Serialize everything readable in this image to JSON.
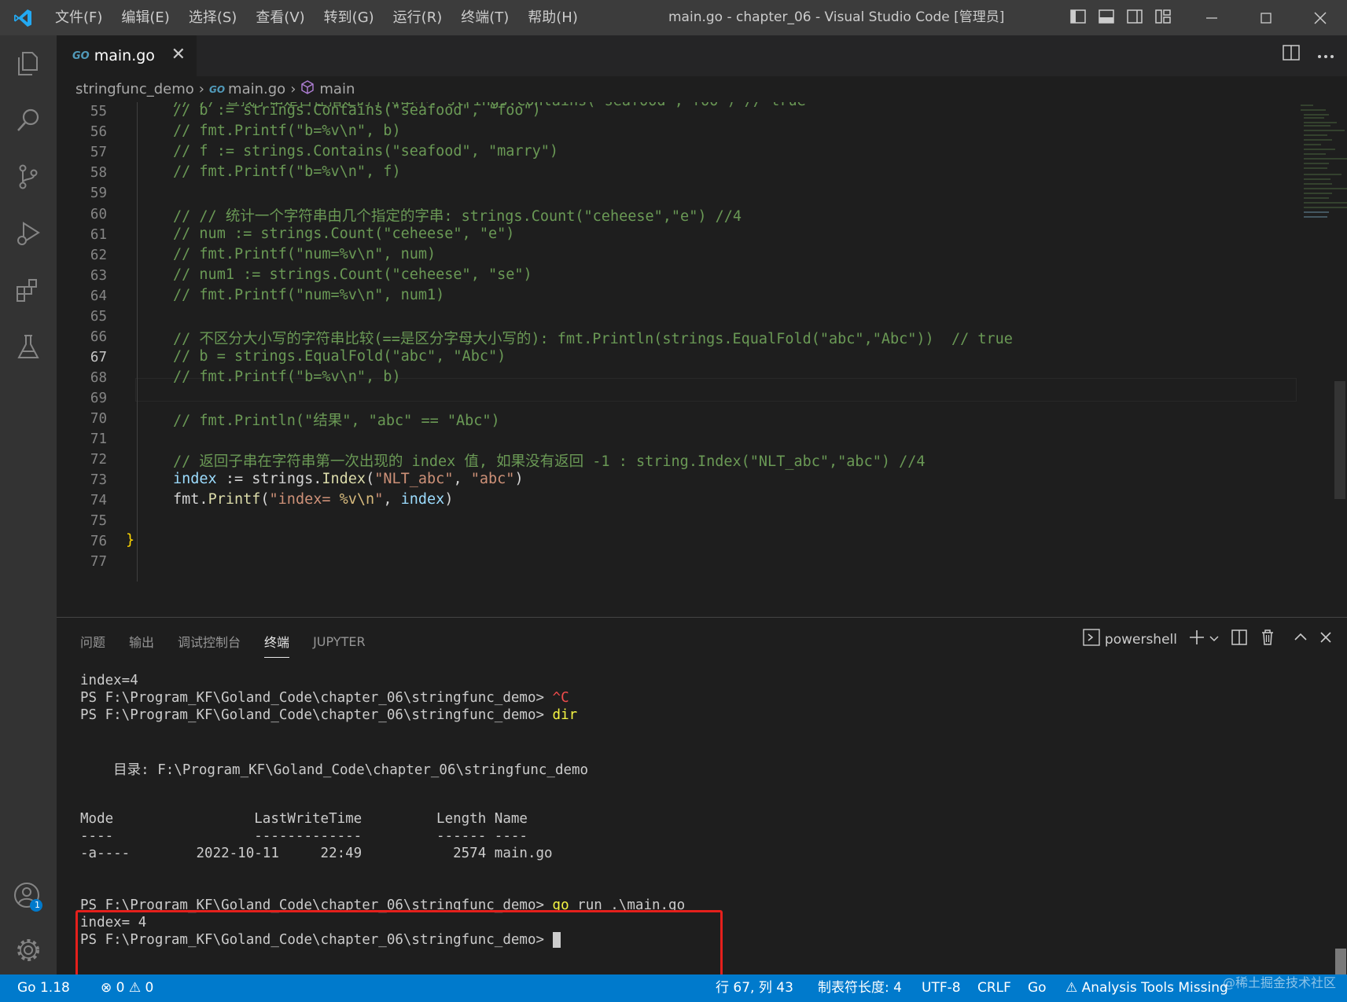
{
  "titlebar": {
    "menus": [
      "文件(F)",
      "编辑(E)",
      "选择(S)",
      "查看(V)",
      "转到(G)",
      "运行(R)",
      "终端(T)",
      "帮助(H)"
    ],
    "title": "main.go - chapter_06 - Visual Studio Code [管理员]"
  },
  "tab": {
    "icon_label": "GO",
    "name": "main.go",
    "close": "✕"
  },
  "breadcrumb": {
    "folder": "stringfunc_demo",
    "file": "main.go",
    "symbol": "main"
  },
  "editor": {
    "line_numbers": [
      "55",
      "56",
      "57",
      "58",
      "59",
      "60",
      "61",
      "62",
      "63",
      "64",
      "65",
      "66",
      "67",
      "68",
      "69",
      "70",
      "71",
      "72",
      "73",
      "74",
      "75",
      "76",
      "77"
    ],
    "current_line": "67",
    "partial_top_line": "// // 查找子串是否在指定的字符串中: strings.Contains(\"seafood\",\"foo\") // true",
    "lines": {
      "l55": "// b := strings.Contains(\"seafood\", \"foo\")",
      "l56": "// fmt.Printf(\"b=%v\\n\", b)",
      "l57": "// f := strings.Contains(\"seafood\", \"marry\")",
      "l58": "// fmt.Printf(\"b=%v\\n\", f)",
      "l60": "// // 统计一个字符串由几个指定的字串: strings.Count(\"ceheese\",\"e\") //4",
      "l61": "// num := strings.Count(\"ceheese\", \"e\")",
      "l62": "// fmt.Printf(\"num=%v\\n\", num)",
      "l63": "// num1 := strings.Count(\"ceheese\", \"se\")",
      "l64": "// fmt.Printf(\"num=%v\\n\", num1)",
      "l66": "// 不区分大小写的字符串比较(==是区分字母大小写的): fmt.Println(strings.EqualFold(\"abc\",\"Abc\"))  // true",
      "l67": "// b = strings.EqualFold(\"abc\", \"Abc\")",
      "l68": "// fmt.Printf(\"b=%v\\n\", b)",
      "l70": "// fmt.Println(\"结果\", \"abc\" == \"Abc\")",
      "l72": "// 返回子串在字符串第一次出现的 index 值, 如果没有返回 -1 : string.Index(\"NLT_abc\",\"abc\") //4",
      "l73": {
        "var": "index",
        "op": " := ",
        "pkg": "strings.",
        "fn": "Index",
        "open": "(",
        "a1": "\"NLT_abc\"",
        "comma": ", ",
        "a2": "\"abc\"",
        "close": ")"
      },
      "l74": {
        "pkg": "fmt.",
        "fn": "Printf",
        "open": "(",
        "s1": "\"index= ",
        "esc1": "%v\\n",
        "s2": "\"",
        "comma": ", ",
        "arg": "index",
        "close": ")"
      },
      "l76": "}"
    }
  },
  "panel": {
    "tabs": [
      "问题",
      "输出",
      "调试控制台",
      "终端",
      "JUPYTER"
    ],
    "active_tab": "终端",
    "shell": "powershell",
    "terminal": {
      "l1": "index=4",
      "l2_prompt": "PS F:\\Program_KF\\Goland_Code\\chapter_06\\stringfunc_demo> ",
      "l2_cmd": "^C",
      "l3_prompt": "PS F:\\Program_KF\\Goland_Code\\chapter_06\\stringfunc_demo> ",
      "l3_cmd": "dir",
      "dir_line": "    目录: F:\\Program_KF\\Goland_Code\\chapter_06\\stringfunc_demo",
      "hdr": "Mode                 LastWriteTime         Length Name",
      "hdr_rule": "----                 -------------         ------ ----",
      "row": "-a----        2022-10-11     22:49           2574 main.go",
      "r1_prompt": "PS F:\\Program_KF\\Goland_Code\\chapter_06\\stringfunc_demo> ",
      "r1_go": "go",
      "r1_rest": " run .\\main.go",
      "r2": "index= 4",
      "r3_prompt": "PS F:\\Program_KF\\Goland_Code\\chapter_06\\stringfunc_demo> "
    }
  },
  "statusbar": {
    "go_version": "Go 1.18",
    "problems": "⊗ 0 ⚠ 0",
    "position": "行 67, 列 43",
    "tab_size": "制表符长度: 4",
    "encoding": "UTF-8",
    "eol": "CRLF",
    "language": "Go",
    "analysis": "⚠ Analysis Tools Missing",
    "watermark": "@稀土掘金技术社区"
  },
  "badges": {
    "accounts": "1"
  },
  "colors": {
    "statusbar": "#007acc",
    "highlight_box": "#e5201c",
    "comment": "#6a9955",
    "string": "#ce9178"
  }
}
